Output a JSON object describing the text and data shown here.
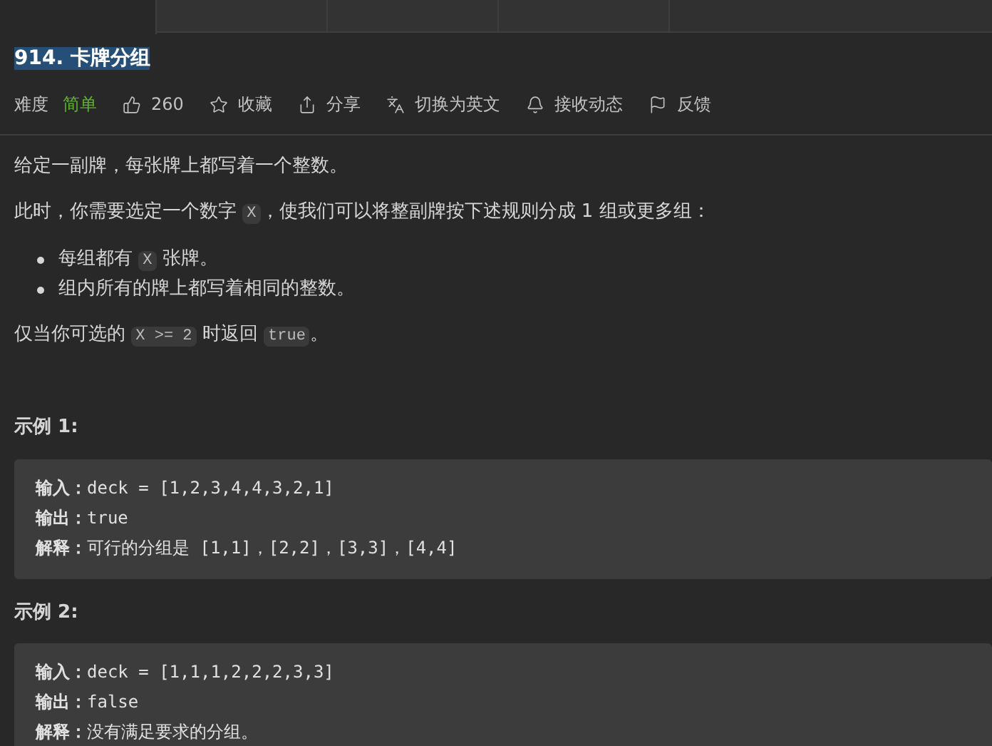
{
  "tabs": [
    {
      "selected": true
    },
    {
      "selected": false
    },
    {
      "selected": false
    },
    {
      "selected": false
    }
  ],
  "title": "914. 卡牌分组",
  "meta": [
    {
      "kind": "difficulty",
      "label": "难度",
      "value": "简单"
    },
    {
      "kind": "like",
      "label": "260"
    },
    {
      "kind": "star",
      "label": "收藏"
    },
    {
      "kind": "share",
      "label": "分享"
    },
    {
      "kind": "translate",
      "label": "切换为英文"
    },
    {
      "kind": "bell",
      "label": "接收动态"
    },
    {
      "kind": "flag",
      "label": "反馈"
    }
  ],
  "description": [
    {
      "kind": "paragraph",
      "segments": [
        {
          "kind": "text",
          "text": "给定一副牌，每张牌上都写着一个整数。"
        }
      ]
    },
    {
      "kind": "paragraph",
      "segments": [
        {
          "kind": "text",
          "text": "此时，你需要选定一个数字 "
        },
        {
          "kind": "code",
          "text": "X"
        },
        {
          "kind": "text",
          "text": "，使我们可以将整副牌按下述规则分成 1 组或更多组："
        }
      ]
    },
    {
      "kind": "bullets",
      "items": [
        [
          {
            "kind": "text",
            "text": "每组都有 "
          },
          {
            "kind": "code",
            "text": "X"
          },
          {
            "kind": "text",
            "text": " 张牌。"
          }
        ],
        [
          {
            "kind": "text",
            "text": "组内所有的牌上都写着相同的整数。"
          }
        ]
      ]
    },
    {
      "kind": "paragraph",
      "segments": [
        {
          "kind": "text",
          "text": "仅当你可选的 "
        },
        {
          "kind": "code",
          "text": "X >= 2"
        },
        {
          "kind": "text",
          "text": " 时返回 "
        },
        {
          "kind": "code",
          "text": "true"
        },
        {
          "kind": "text",
          "text": "。"
        }
      ]
    }
  ],
  "examples": [
    {
      "heading": "示例 1:",
      "lines": [
        "**输入：**deck = [1,2,3,4,4,3,2,1]",
        "**输出：**true",
        "**解释：**可行的分组是 [1,1]，[2,2]，[3,3]，[4,4]"
      ]
    },
    {
      "heading": "示例 2:",
      "lines": [
        "**输入：**deck = [1,1,1,2,2,2,3,3]",
        "**输出：**false",
        "**解释：**没有满足要求的分组。"
      ]
    }
  ]
}
